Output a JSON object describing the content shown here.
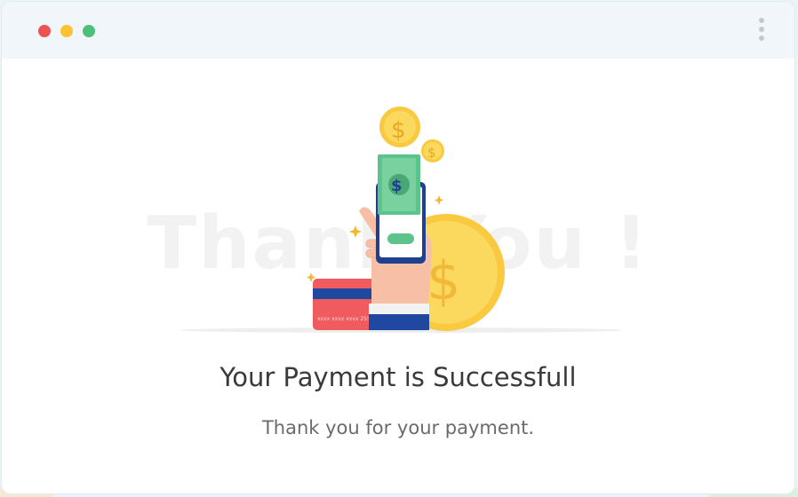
{
  "window": {
    "controls": [
      "close-dot",
      "minimize-dot",
      "maximize-dot"
    ],
    "menu_icon": "kebab-menu-icon"
  },
  "watermark": {
    "text": "Thank You !"
  },
  "illustration": {
    "icon": "payment-success-illustration",
    "coin_symbol": "$",
    "card_number": "xxxx xxxx xxxx 2552",
    "colors": {
      "coin": "#fbd44a",
      "banknote": "#5cc48a",
      "phone": "#1f3f8f",
      "card": "#ef5b5f",
      "sleeve": "#2148a0",
      "skin": "#f7c0a6"
    }
  },
  "message": {
    "headline": "Your Payment is Successfull",
    "subtext": "Thank you for your payment."
  }
}
